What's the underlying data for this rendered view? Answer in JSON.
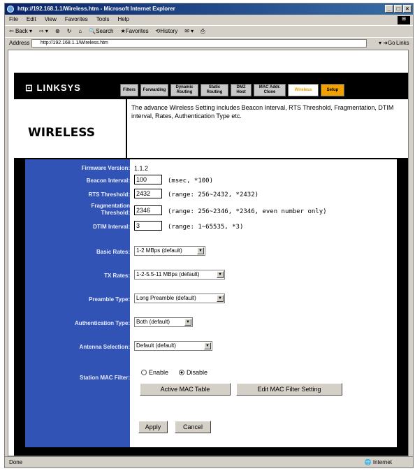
{
  "browser": {
    "title": "http://192.168.1.1/Wireless.htm - Microsoft Internet Explorer",
    "menu": [
      "File",
      "Edit",
      "View",
      "Favorites",
      "Tools",
      "Help"
    ],
    "toolbar": [
      "Back",
      "Search",
      "Favorites",
      "History"
    ],
    "address_label": "Address",
    "address_value": "http://192.168.1.1/Wireless.htm",
    "go_label": "Go",
    "links_label": "Links",
    "status_left": "Done",
    "status_zone": "Internet"
  },
  "page": {
    "logo": "LINKSYS",
    "tabs": [
      "Filters",
      "Forwarding",
      "Dynamic Routing",
      "Static Routing",
      "DMZ Host",
      "MAC Addr. Clone",
      "Wireless",
      "Setup"
    ],
    "section_title": "WIRELESS",
    "description": "The advance Wireless Setting includes Beacon Interval, RTS Threshold, Fragmentation, DTIM interval, Rates, Authentication Type etc."
  },
  "form": {
    "firmware_label": "Firmware Version:",
    "firmware_value": "1.1.2",
    "beacon_label": "Beacon Interval:",
    "beacon_value": "100",
    "beacon_hint": "(msec, *100)",
    "rts_label": "RTS Threshold:",
    "rts_value": "2432",
    "rts_hint": "(range: 256~2432, *2432)",
    "frag_label": "Fragmentation Threshold:",
    "frag_value": "2346",
    "frag_hint": "(range: 256~2346, *2346, even number only)",
    "dtim_label": "DTIM Interval:",
    "dtim_value": "3",
    "dtim_hint": "(range: 1~65535, *3)",
    "basic_rates_label": "Basic Rates:",
    "basic_rates_value": "1-2 MBps (default)",
    "tx_rates_label": "TX Rates:",
    "tx_rates_value": "1-2-5.5-11 MBps (default)",
    "preamble_label": "Preamble Type:",
    "preamble_value": "Long Preamble (default)",
    "auth_label": "Authentication Type:",
    "auth_value": "Both (default)",
    "antenna_label": "Antenna Selection:",
    "antenna_value": "Default (default)",
    "mac_filter_label": "Station MAC Filter:",
    "enable_label": "Enable",
    "disable_label": "Disable",
    "active_mac_button": "Active MAC Table",
    "edit_mac_button": "Edit MAC Filter Setting",
    "apply_button": "Apply",
    "cancel_button": "Cancel"
  },
  "colors": {
    "left_panel": "#3153b5",
    "setup_tab": "#f0a000",
    "active_tab_text": "#e0a000"
  }
}
